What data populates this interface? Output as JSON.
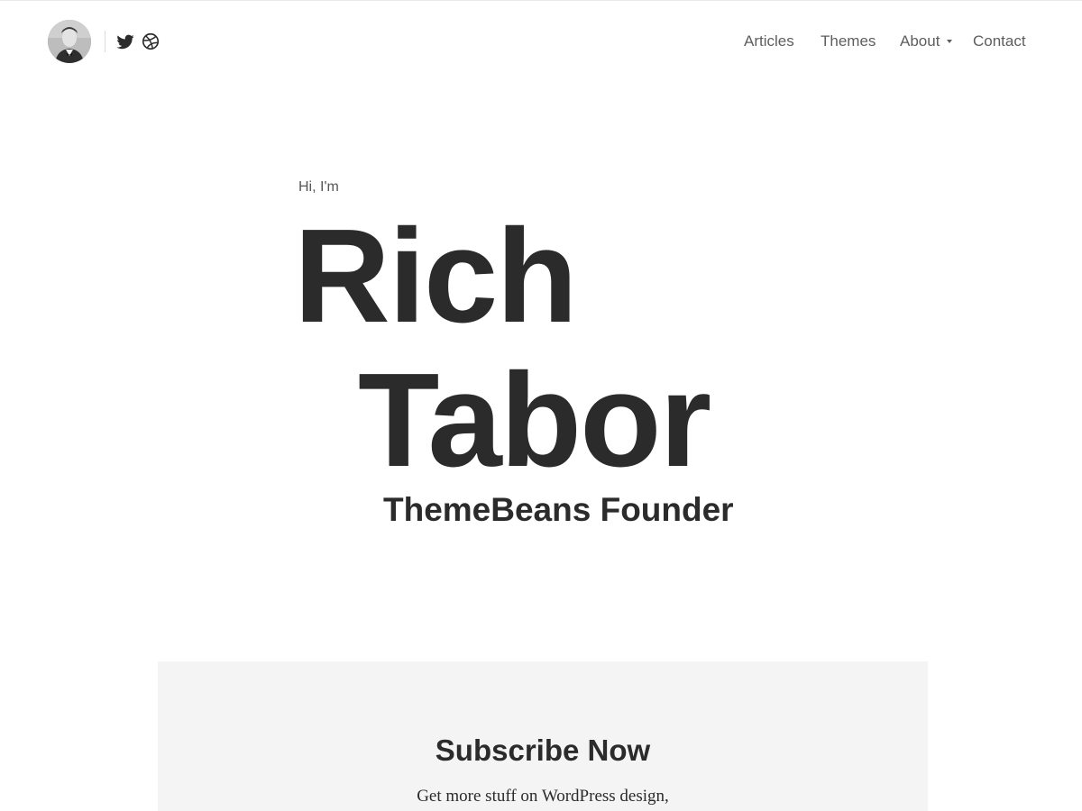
{
  "header": {
    "avatar_alt": "Rich Tabor avatar",
    "social": [
      {
        "icon": "twitter-icon"
      },
      {
        "icon": "dribbble-icon"
      }
    ],
    "nav": {
      "articles": "Articles",
      "themes": "Themes",
      "about": "About",
      "contact": "Contact"
    }
  },
  "hero": {
    "greeting": "Hi, I'm",
    "first_name": "Rich",
    "last_name": "Tabor",
    "role": "ThemeBeans Founder"
  },
  "subscribe": {
    "title": "Subscribe Now",
    "text": "Get more stuff on WordPress design,"
  },
  "colors": {
    "text": "#2b2b2b",
    "nav_text": "#5e5e5e",
    "panel_bg": "#f4f4f4"
  }
}
